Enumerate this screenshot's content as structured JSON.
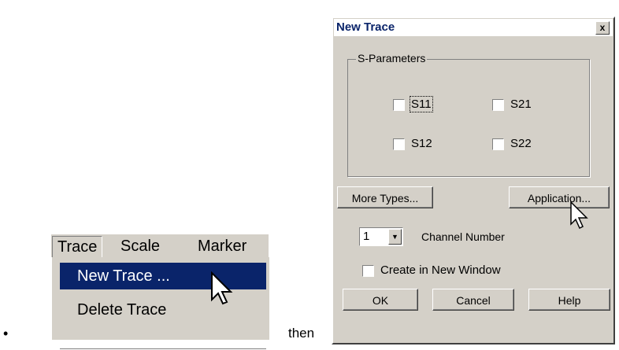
{
  "menu": {
    "menubar": [
      "Trace",
      "Scale",
      "Marker"
    ],
    "items": [
      "New Trace ...",
      "Delete Trace"
    ]
  },
  "connector": {
    "bullet": "•",
    "then": "then"
  },
  "dialog": {
    "title": "New Trace",
    "close": "x",
    "group_label": "S-Parameters",
    "params": [
      "S11",
      "S21",
      "S12",
      "S22"
    ],
    "more_types": "More Types...",
    "application": "Application...",
    "channel_value": "1",
    "channel_label": "Channel Number",
    "new_window": "Create in New Window",
    "ok": "OK",
    "cancel": "Cancel",
    "help": "Help"
  },
  "icons": {
    "cursor": "arrow-cursor-icon",
    "dropdown": "dropdown-arrow-icon"
  },
  "colors": {
    "highlight": "#0a246a",
    "face": "#d4d0c8"
  }
}
